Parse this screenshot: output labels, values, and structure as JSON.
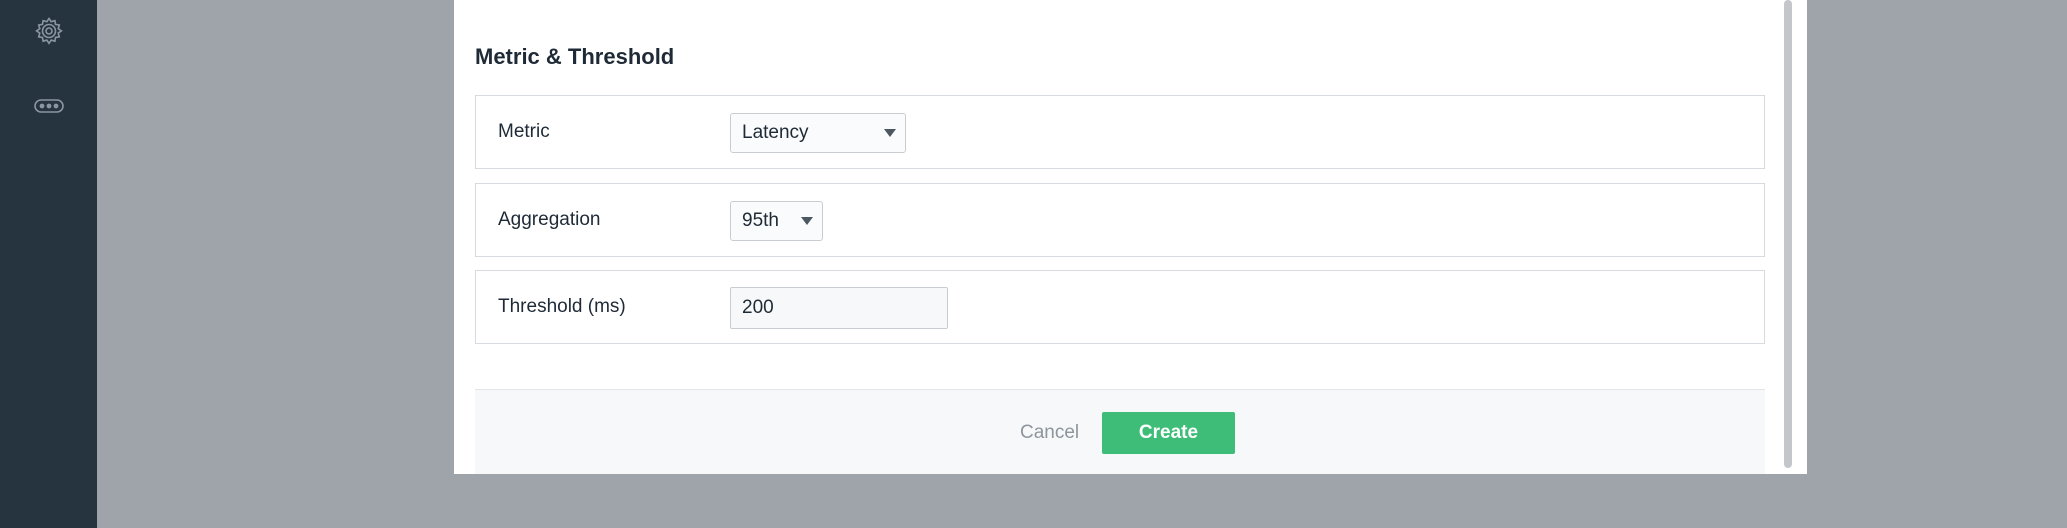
{
  "sidebar": {
    "items": [
      {
        "icon": "gear-icon"
      },
      {
        "icon": "more-dots-icon"
      }
    ]
  },
  "modal": {
    "section_title": "Metric & Threshold",
    "fields": {
      "metric": {
        "label": "Metric",
        "value": "Latency"
      },
      "aggregation": {
        "label": "Aggregation",
        "value": "95th"
      },
      "threshold": {
        "label": "Threshold (ms)",
        "value": "200"
      }
    },
    "footer": {
      "cancel_label": "Cancel",
      "create_label": "Create"
    }
  },
  "colors": {
    "sidebar_bg": "#26343f",
    "overlay_bg": "#9fa3aa",
    "primary": "#3dbd78"
  }
}
